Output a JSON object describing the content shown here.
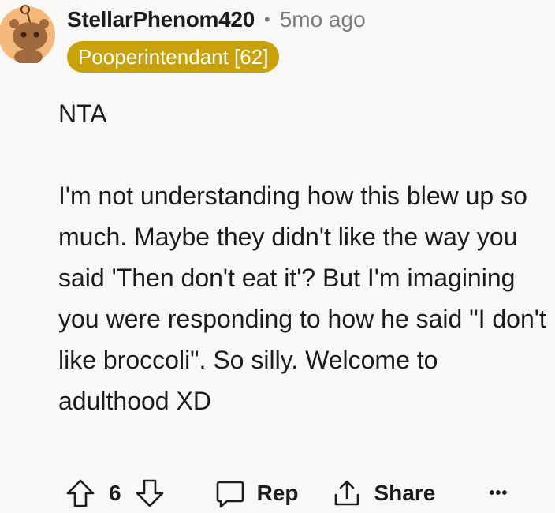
{
  "comment": {
    "username": "StellarPhenom420",
    "separator": "•",
    "time": "5mo ago",
    "flair": "Pooperintendant [62]",
    "paragraphs": [
      "NTA",
      "I'm not understanding how this blew up so much. Maybe they didn't like the way you said 'Then don't eat it'? But I'm imagining you were responding to how he said \"I don't like broccoli\". So silly. Welcome to adulthood XD"
    ]
  },
  "actions": {
    "vote_count": "6",
    "reply_label": "Rep",
    "share_label": "Share",
    "more_label": "•••"
  },
  "colors": {
    "flair_bg": "#c9a20a",
    "avatar_bg": "#f6b77a",
    "text": "#1c1c1c",
    "muted": "#7c7c7c",
    "background": "#f9f8f6"
  }
}
